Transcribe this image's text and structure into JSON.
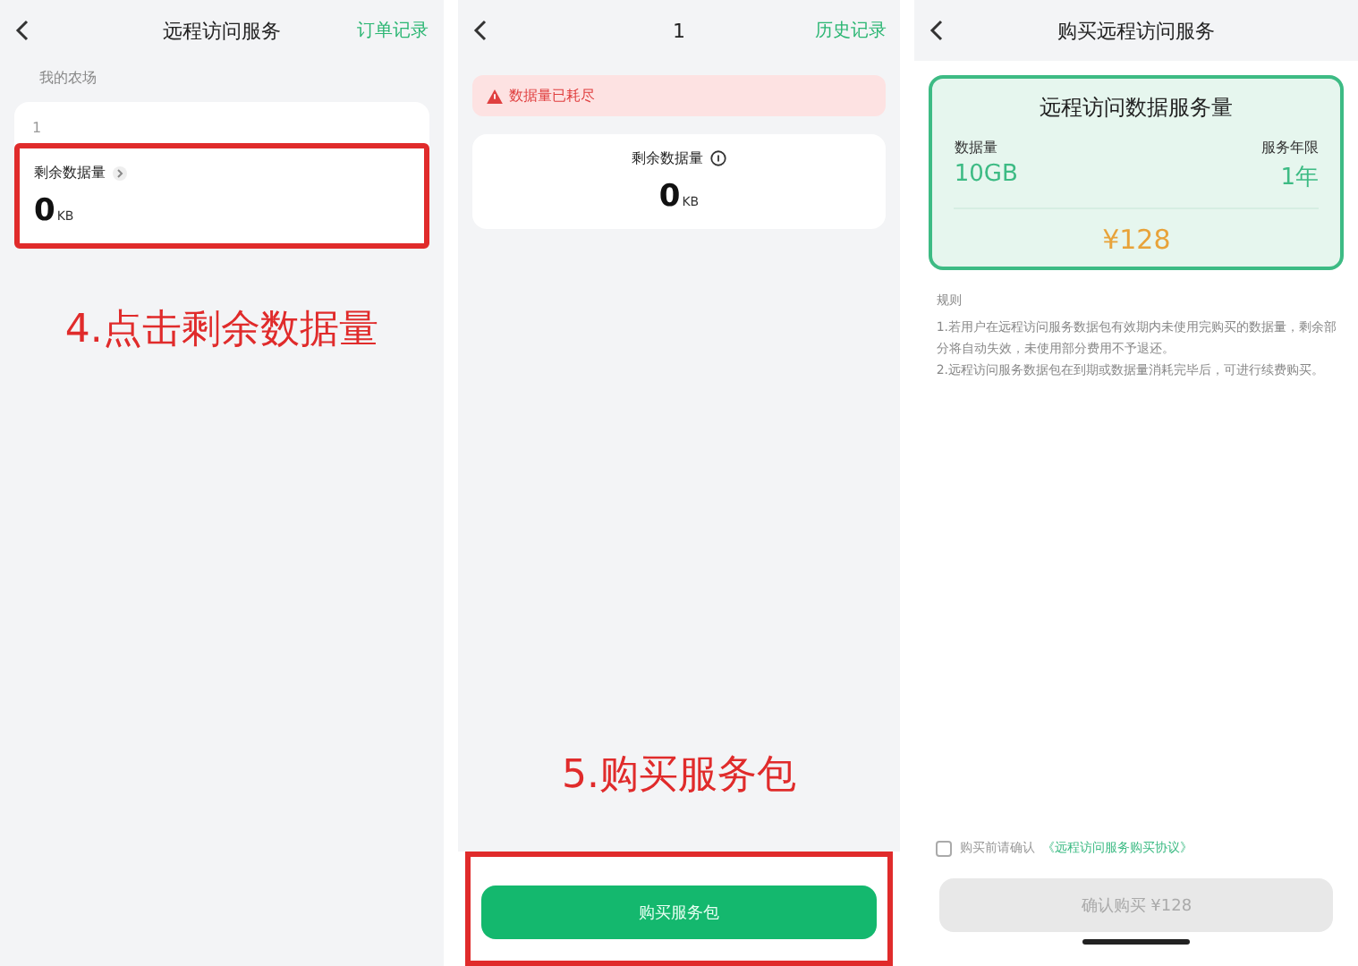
{
  "panels": [
    {
      "header": {
        "title": "远程访问服务",
        "action": "订单记录"
      },
      "section_label": "我的农场",
      "farm_name": "1",
      "remaining": {
        "label": "剩余数据量",
        "value": "0",
        "unit": "KB",
        "highlighted": true
      },
      "annotation": "4.点击剩余数据量"
    },
    {
      "header": {
        "title": "1",
        "action": "历史记录"
      },
      "alert": "数据量已耗尽",
      "remaining": {
        "label": "剩余数据量",
        "value": "0",
        "unit": "KB"
      },
      "annotation": "5.购买服务包",
      "buy_button": {
        "label": "购买服务包",
        "highlighted": true
      }
    },
    {
      "header": {
        "title": "购买远程访问服务"
      },
      "package": {
        "title": "远程访问数据服务量",
        "data_label": "数据量",
        "data_value": "10GB",
        "term_label": "服务年限",
        "term_value": "1年",
        "price": "¥128",
        "selected": true
      },
      "rules_title": "规则",
      "rules": [
        "1.若用户在远程访问服务数据包有效期内未使用完购买的数据量，剩余部分将自动失效，未使用部分费用不予退还。",
        "2.远程访问服务数据包在到期或数据量消耗完毕后，可进行续费购买。"
      ],
      "agreement": {
        "text": "购买前请确认",
        "link": "《远程访问服务购买协议》",
        "checked": false
      },
      "confirm_button": {
        "label": "确认购买 ¥128",
        "disabled": true
      }
    }
  ]
}
